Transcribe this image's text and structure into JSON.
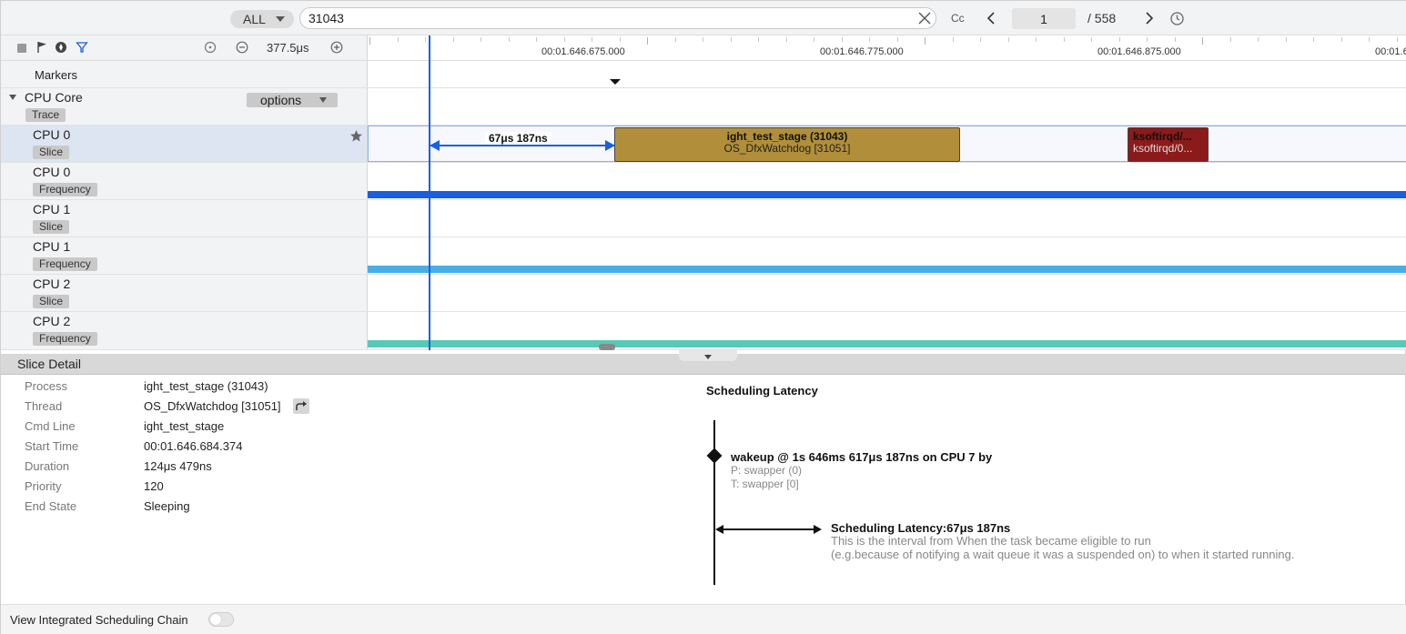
{
  "colors": {
    "accent": "#1a5fe0",
    "freq_cpu0": "#1a5fe0",
    "freq_cpu1": "#47afe3",
    "freq_cpu2": "#57c9b7",
    "slice_gold": "#b18f3a",
    "slice_red": "#8b1a1a"
  },
  "search": {
    "scope": "ALL",
    "query": "31043",
    "case_label": "Cc",
    "current_page": "1",
    "total_label": "/  558"
  },
  "toolbar": {
    "zoom_value": "377.5μs"
  },
  "ruler": {
    "ticks": [
      "00:01.646.675.000",
      "00:01.646.775.000",
      "00:01.646.875.000",
      "00:01.6"
    ]
  },
  "tracks": {
    "markers_label": "Markers",
    "group": {
      "name": "CPU Core",
      "tag": "Trace",
      "options_label": "options"
    },
    "rows": [
      {
        "name": "CPU 0",
        "tag": "Slice"
      },
      {
        "name": "CPU 0",
        "tag": "Frequency"
      },
      {
        "name": "CPU 1",
        "tag": "Slice"
      },
      {
        "name": "CPU 1",
        "tag": "Frequency"
      },
      {
        "name": "CPU 2",
        "tag": "Slice"
      },
      {
        "name": "CPU 2",
        "tag": "Frequency"
      }
    ]
  },
  "timeline": {
    "latency_label": "67μs 187ns",
    "slice_main": {
      "title": "ight_test_stage (31043)",
      "subtitle": "OS_DfxWatchdog [31051]"
    },
    "slice_red": {
      "title": "ksoftirqd/...",
      "subtitle": "ksoftirqd/0..."
    }
  },
  "detail": {
    "title": "Slice Detail",
    "fields": [
      {
        "key": "Process",
        "value": "ight_test_stage (31043)"
      },
      {
        "key": "Thread",
        "value": "OS_DfxWatchdog [31051]"
      },
      {
        "key": "Cmd Line",
        "value": "ight_test_stage"
      },
      {
        "key": "Start Time",
        "value": "00:01.646.684.374"
      },
      {
        "key": "Duration",
        "value": "124μs 479ns"
      },
      {
        "key": "Priority",
        "value": "120"
      },
      {
        "key": "End State",
        "value": "Sleeping"
      }
    ],
    "sched": {
      "title": "Scheduling Latency",
      "wakeup": "wakeup @ 1s 646ms 617μs 187ns on CPU 7 by",
      "process": "P: swapper (0)",
      "thread": "T: swapper [0]",
      "latency": "Scheduling Latency:67μs 187ns",
      "desc1": "This is the interval from When the task became eligible to run",
      "desc2": "(e.g.because of notifying a wait queue it was a suspended on) to when it started running."
    }
  },
  "bottom": {
    "chain_label": "View Integrated Scheduling Chain"
  }
}
